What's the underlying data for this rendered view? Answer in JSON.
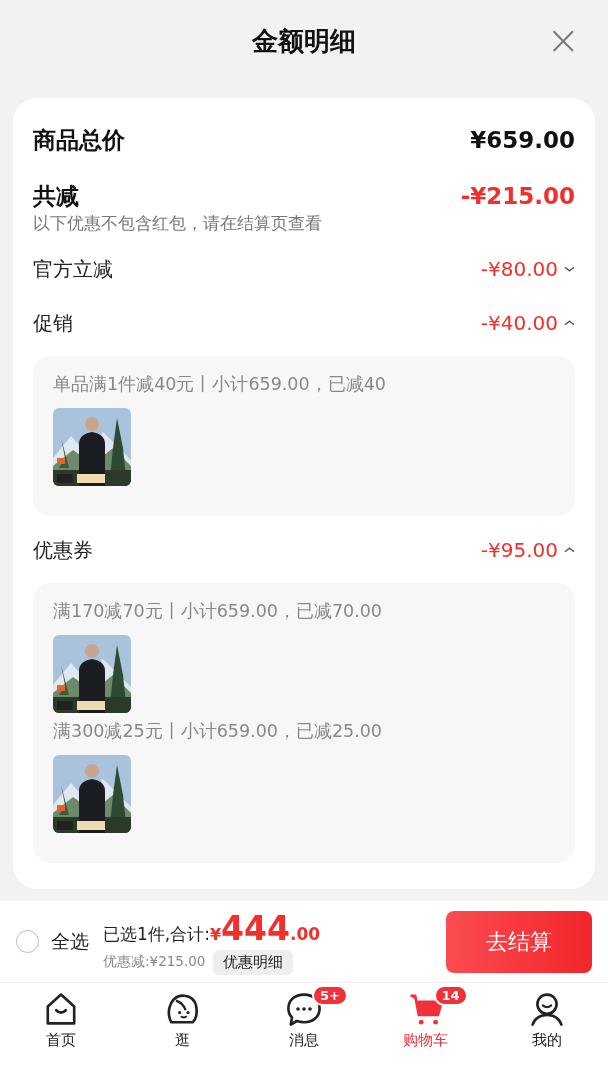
{
  "header": {
    "title": "金额明细",
    "close": "×"
  },
  "summary": {
    "total_label": "商品总价",
    "total_amount": "¥659.00",
    "reduce_label": "共减",
    "reduce_amount": "-¥215.00",
    "reduce_note": "以下优惠不包含红包，请在结算页查看"
  },
  "sections": [
    {
      "label": "官方立减",
      "amount": "-¥80.00",
      "expanded": false
    },
    {
      "label": "促销",
      "amount": "-¥40.00",
      "expanded": true,
      "groups": [
        {
          "rule": "单品满1件减40元丨小计659.00，已减40"
        }
      ]
    },
    {
      "label": "优惠券",
      "amount": "-¥95.00",
      "expanded": true,
      "groups": [
        {
          "rule": "满170减70元丨小计659.00，已减70.00"
        },
        {
          "rule": "满300减25元丨小计659.00，已减25.00"
        }
      ]
    }
  ],
  "checkout_bar": {
    "select_all": {
      "label": "全选",
      "checked": false
    },
    "selected_text": "已选1件,合计:",
    "currency": "¥",
    "price_integer": "444",
    "price_decimal": ".00",
    "discount_text": "优惠减:¥215.00",
    "detail_button": "优惠明细",
    "checkout_button": "去结算"
  },
  "tabs": [
    {
      "label": "首页",
      "kind": "home",
      "selected": false
    },
    {
      "label": "逛",
      "kind": "browse",
      "selected": false
    },
    {
      "label": "消息",
      "kind": "message",
      "selected": false,
      "badge": "5+"
    },
    {
      "label": "购物车",
      "kind": "cart",
      "selected": true,
      "badge": "14"
    },
    {
      "label": "我的",
      "kind": "profile",
      "selected": false
    }
  ]
}
